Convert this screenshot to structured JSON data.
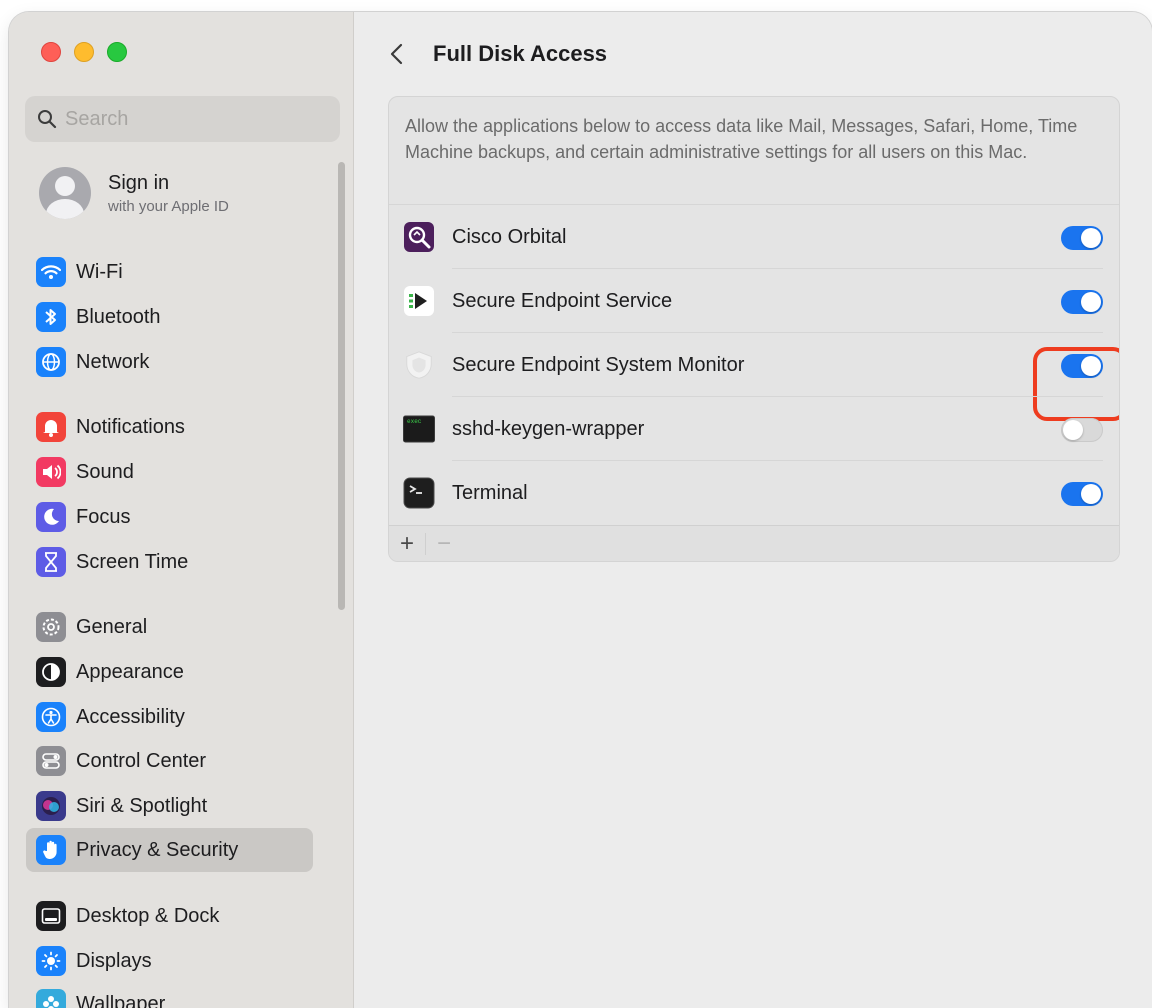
{
  "sidebar": {
    "search_placeholder": "Search",
    "account": {
      "title": "Sign in",
      "subtitle": "with your Apple ID"
    },
    "items": [
      {
        "label": "Wi-Fi",
        "icon": "wifi-icon",
        "color": "#1a82fb"
      },
      {
        "label": "Bluetooth",
        "icon": "bluetooth-icon",
        "color": "#1a82fb"
      },
      {
        "label": "Network",
        "icon": "globe-icon",
        "color": "#1a82fb"
      },
      {
        "label": "Notifications",
        "icon": "bell-icon",
        "color": "#f2443a"
      },
      {
        "label": "Sound",
        "icon": "speaker-icon",
        "color": "#f23a62"
      },
      {
        "label": "Focus",
        "icon": "moon-icon",
        "color": "#5e5ce6"
      },
      {
        "label": "Screen Time",
        "icon": "hourglass-icon",
        "color": "#5e5ce6"
      },
      {
        "label": "General",
        "icon": "gear-icon",
        "color": "#8e8e93"
      },
      {
        "label": "Appearance",
        "icon": "appearance-icon",
        "color": "#1d1d1f"
      },
      {
        "label": "Accessibility",
        "icon": "accessibility-icon",
        "color": "#1a82fb"
      },
      {
        "label": "Control Center",
        "icon": "control-center-icon",
        "color": "#8e8e93"
      },
      {
        "label": "Siri & Spotlight",
        "icon": "siri-icon",
        "color": "#3a3a8c"
      },
      {
        "label": "Privacy & Security",
        "icon": "hand-icon",
        "color": "#1a82fb",
        "active": true
      },
      {
        "label": "Desktop & Dock",
        "icon": "dock-icon",
        "color": "#1d1d1f"
      },
      {
        "label": "Displays",
        "icon": "sun-icon",
        "color": "#1a82fb"
      },
      {
        "label": "Wallpaper",
        "icon": "wallpaper-icon",
        "color": "#34aadc"
      }
    ]
  },
  "main": {
    "title": "Full Disk Access",
    "description": "Allow the applications below to access data like Mail, Messages, Safari, Home, Time Machine backups, and certain administrative settings for all users on this Mac.",
    "apps": [
      {
        "name": "Cisco Orbital",
        "icon": "cisco-orbital-icon",
        "enabled": true
      },
      {
        "name": "Secure Endpoint Service",
        "icon": "secure-endpoint-service-icon",
        "enabled": true
      },
      {
        "name": "Secure Endpoint System Monitor",
        "icon": "shield-icon",
        "enabled": true,
        "highlighted": true
      },
      {
        "name": "sshd-keygen-wrapper",
        "icon": "terminal-exec-icon",
        "enabled": false
      },
      {
        "name": "Terminal",
        "icon": "terminal-icon",
        "enabled": true
      }
    ],
    "footer": {
      "add": "+",
      "remove": "−"
    }
  },
  "colors": {
    "accent": "#1a74ef",
    "highlight": "#ee3c1f"
  }
}
